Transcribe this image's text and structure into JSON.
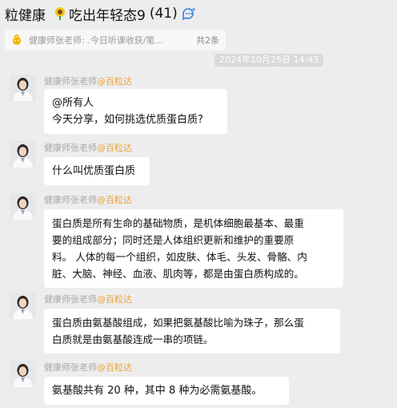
{
  "header": {
    "group_name": "粒健康",
    "group_subtitle": "吃出年轻态9",
    "member_count": "(41)",
    "sunflower_icon": "sunflower-emoji-icon",
    "ai_icon": "ai-summary-icon"
  },
  "notice": {
    "icon": "announcement-icon",
    "text": "健康师张老师: .今日听课收获/笔...",
    "count": "共2条"
  },
  "timestamp": "2024年10月25日 14:43",
  "messages": [
    {
      "sender_name": "健康师张老师",
      "sender_tag": "@百粒达",
      "lines": [
        "@所有人",
        "今天分享，如何挑选优质蛋白质?"
      ]
    },
    {
      "sender_name": "健康师张老师",
      "sender_tag": "@百粒达",
      "lines": [
        "什么叫优质蛋白质"
      ]
    },
    {
      "sender_name": "健康师张老师",
      "sender_tag": "@百粒达",
      "lines": [
        "蛋白质是所有生命的基础物质，是机体细胞最基本、最重",
        "要的组成部分；同时还是人体组织更新和维护的重要原",
        "料。 人体的每一个组织，如皮肤、体毛、头发、骨骼、内",
        "脏、大脑、神经、血液、肌肉等，都是由蛋白质构成的。"
      ]
    },
    {
      "sender_name": "健康师张老师",
      "sender_tag": "@百粒达",
      "lines": [
        "蛋白质由氨基酸组成，如果把氨基酸比喻为珠子，那么蛋",
        "白质就是由氨基酸连成一串的项链。"
      ]
    },
    {
      "sender_name": "健康师张老师",
      "sender_tag": "@百粒达",
      "lines": [
        "氨基酸共有 20 种，其中 8 种为必需氨基酸。"
      ]
    }
  ],
  "colors": {
    "background": "#ededed",
    "bubble": "#ffffff",
    "sender_tag": "#e8a33a",
    "sender_name": "#a8a8a8"
  }
}
